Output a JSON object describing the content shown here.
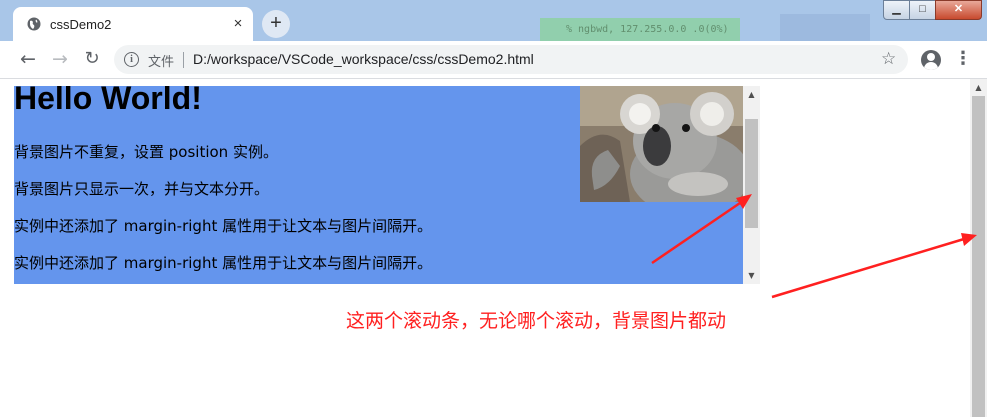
{
  "browser": {
    "tab": {
      "title": "cssDemo2",
      "close_glyph": "×"
    },
    "new_tab_glyph": "+",
    "background_window_text": "% ngbwd, 127.255.0.0 .0(0%)",
    "window_controls": {
      "minimize": "▁",
      "maximize": "□",
      "close": "✕"
    },
    "toolbar": {
      "back_glyph": "←",
      "forward_glyph": "→",
      "reload_glyph": "↻",
      "info_glyph": "i",
      "protocol_label": "文件",
      "url": "D:/workspace/VSCode_workspace/css/cssDemo2.html",
      "bookmark_glyph": "☆",
      "menu_glyph": "⋮"
    },
    "icons": [
      "globe-icon",
      "close-icon",
      "plus-icon",
      "back-icon",
      "forward-icon",
      "reload-icon",
      "info-icon",
      "star-icon",
      "account-icon",
      "more-vert-icon"
    ]
  },
  "page": {
    "heading": "Hello World!",
    "paragraphs": [
      "背景图片不重复，设置 position 实例。",
      "背景图片只显示一次，并与文本分开。",
      "实例中还添加了 margin-right 属性用于让文本与图片间隔开。",
      "实例中还添加了 margin-right 属性用于让文本与图片间隔开。"
    ],
    "background_color": "#6495ed",
    "image_subject": "koala",
    "scroll_up_glyph": "▲",
    "scroll_down_glyph": "▼"
  },
  "annotation": {
    "text": "这两个滚动条，无论哪个滚动，背景图片都动",
    "color": "#ff2020"
  }
}
